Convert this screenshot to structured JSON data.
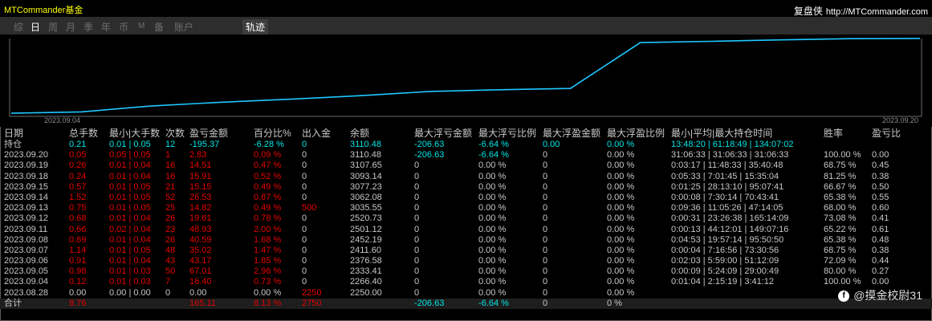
{
  "app": {
    "title": "MTCommander基金",
    "brand_cn": "复盘侠",
    "brand_url": "http://MTCommander.com"
  },
  "tabs": [
    {
      "label": "综",
      "active": false
    },
    {
      "label": "日",
      "active": true
    },
    {
      "label": "周",
      "active": false
    },
    {
      "label": "月",
      "active": false
    },
    {
      "label": "季",
      "active": false
    },
    {
      "label": "年",
      "active": false
    },
    {
      "label": "币",
      "active": false
    },
    {
      "label": "M",
      "active": false
    },
    {
      "label": "备",
      "active": false
    },
    {
      "label": "账户",
      "active": false
    }
  ],
  "trace_tab": "轨迹",
  "chart": {
    "start_label": "2023.09.04",
    "end_label": "2023.09.20",
    "line_color": "#1ec8ff",
    "axis_color": "#6e6e6e"
  },
  "chart_data": {
    "type": "line",
    "x": [
      "2023.08.28",
      "2023.09.04",
      "2023.09.05",
      "2023.09.06",
      "2023.09.07",
      "2023.09.08",
      "2023.09.11",
      "2023.09.12",
      "2023.09.13",
      "2023.09.14",
      "2023.09.15",
      "2023.09.18",
      "2023.09.19",
      "2023.09.20"
    ],
    "series": [
      {
        "values": [
          2250.0,
          2266.4,
          2333.41,
          2376.58,
          2411.6,
          2452.19,
          2501.12,
          2520.73,
          2535.55,
          3062.08,
          3077.23,
          3093.14,
          3107.65,
          3110.48
        ]
      }
    ]
  },
  "table": {
    "headers": [
      "日期",
      "总手数",
      "最小|大手数",
      "次数",
      "盈亏金额",
      "百分比%",
      "出入金",
      "余额",
      "最大浮亏金额",
      "最大浮亏比例",
      "最大浮盈金额",
      "最大浮盈比例",
      "最小|平均|最大持仓时间",
      "胜率",
      "盈亏比"
    ],
    "holding": [
      "持仓",
      "0.21",
      "0.01 | 0.05",
      "12",
      "-195.37",
      "-6.28 %",
      "0",
      "3110.48",
      "-206.63",
      "-6.64 %",
      "0.00",
      "0.00 %",
      "13:48:20 | 61:18:49 | 134:07:02",
      "",
      ""
    ],
    "rows": [
      [
        "2023.09.20",
        "0.05",
        "0.05 | 0.05",
        "1",
        "2.83",
        "0.09 %",
        "0",
        "3110.48",
        "-206.63",
        "-6.64 %",
        "0",
        "0.00 %",
        "31:06:33 | 31:06:33 | 31:06:33",
        "100.00 %",
        "0.00"
      ],
      [
        "2023.09.19",
        "0.26",
        "0.01 | 0.04",
        "16",
        "14.51",
        "0.47 %",
        "0",
        "3107.65",
        "0",
        "0.00 %",
        "0",
        "0.00 %",
        "0:03:17 | 11:48:33 | 35:40:48",
        "68.75 %",
        "0.45"
      ],
      [
        "2023.09.18",
        "0.24",
        "0.01 | 0.04",
        "16",
        "15.91",
        "0.52 %",
        "0",
        "3093.14",
        "0",
        "0.00 %",
        "0",
        "0.00 %",
        "0:05:33 | 7:01:45 | 15:35:04",
        "81.25 %",
        "0.38"
      ],
      [
        "2023.09.15",
        "0.57",
        "0.01 | 0.05",
        "21",
        "15.15",
        "0.49 %",
        "0",
        "3077.23",
        "0",
        "0.00 %",
        "0",
        "0.00 %",
        "0:01:25 | 28:13:10 | 95:07:41",
        "66.67 %",
        "0.50"
      ],
      [
        "2023.09.14",
        "1.52",
        "0.01 | 0.05",
        "52",
        "26.53",
        "0.87 %",
        "0",
        "3062.08",
        "0",
        "0.00 %",
        "0",
        "0.00 %",
        "0:00:08 | 7:30:14 | 70:43:41",
        "65.38 %",
        "0.55"
      ],
      [
        "2023.09.13",
        "0.75",
        "0.01 | 0.05",
        "25",
        "14.82",
        "0.49 %",
        "500",
        "3035.55",
        "0",
        "0.00 %",
        "0",
        "0.00 %",
        "0:09:36 | 11:05:26 | 47:14:05",
        "68.00 %",
        "0.60"
      ],
      [
        "2023.09.12",
        "0.68",
        "0.01 | 0.04",
        "26",
        "19.61",
        "0.78 %",
        "0",
        "2520.73",
        "0",
        "0.00 %",
        "0",
        "0.00 %",
        "0:00:31 | 23:26:38 | 165:14:09",
        "73.08 %",
        "0.41"
      ],
      [
        "2023.09.11",
        "0.66",
        "0.02 | 0.04",
        "23",
        "48.93",
        "2.00 %",
        "0",
        "2501.12",
        "0",
        "0.00 %",
        "0",
        "0.00 %",
        "0:00:13 | 44:12:01 | 149:07:16",
        "65.22 %",
        "0.61"
      ],
      [
        "2023.09.08",
        "0.69",
        "0.01 | 0.04",
        "26",
        "40.59",
        "1.68 %",
        "0",
        "2452.19",
        "0",
        "0.00 %",
        "0",
        "0.00 %",
        "0:04:53 | 19:57:14 | 95:50:50",
        "65.38 %",
        "0.48"
      ],
      [
        "2023.09.07",
        "1.14",
        "0.01 | 0.05",
        "48",
        "35.02",
        "1.47 %",
        "0",
        "2411.60",
        "0",
        "0.00 %",
        "0",
        "0.00 %",
        "0:00:04 | 7:16:56 | 73:30:56",
        "68.75 %",
        "0.38"
      ],
      [
        "2023.09.06",
        "0.91",
        "0.01 | 0.04",
        "43",
        "43.17",
        "1.85 %",
        "0",
        "2376.58",
        "0",
        "0.00 %",
        "0",
        "0.00 %",
        "0:02:03 | 5:59:00 | 51:12:09",
        "72.09 %",
        "0.44"
      ],
      [
        "2023.09.05",
        "0.98",
        "0.01 | 0.03",
        "50",
        "67.01",
        "2.96 %",
        "0",
        "2333.41",
        "0",
        "0.00 %",
        "0",
        "0.00 %",
        "0:00:09 | 5:24:09 | 29:00:49",
        "80.00 %",
        "0.27"
      ],
      [
        "2023.09.04",
        "0.12",
        "0.01 | 0.03",
        "7",
        "16.40",
        "0.73 %",
        "0",
        "2266.40",
        "0",
        "0.00 %",
        "0",
        "0.00 %",
        "0:01:04 | 2:15:19 | 3:41:12",
        "100.00 %",
        "0.00"
      ],
      [
        "2023.08.28",
        "0.00",
        "0.00 | 0.00",
        "0",
        "0.00",
        "0.00 %",
        "2250",
        "2250.00",
        "0",
        "0.00 %",
        "0",
        "0.00 %",
        "",
        "",
        ""
      ]
    ],
    "total": [
      "合计",
      "8.76",
      "",
      "",
      "165.11",
      "8.13 %",
      "2750",
      "",
      "-206.63",
      "-6.64 %",
      "0",
      "0 %",
      "",
      "",
      ""
    ]
  },
  "watermark": {
    "icon_text": "f",
    "text": "@摸金校尉31"
  },
  "colors": {
    "profit": "#e60000",
    "cyan": "#00e5e5",
    "title": "#ffff00"
  }
}
